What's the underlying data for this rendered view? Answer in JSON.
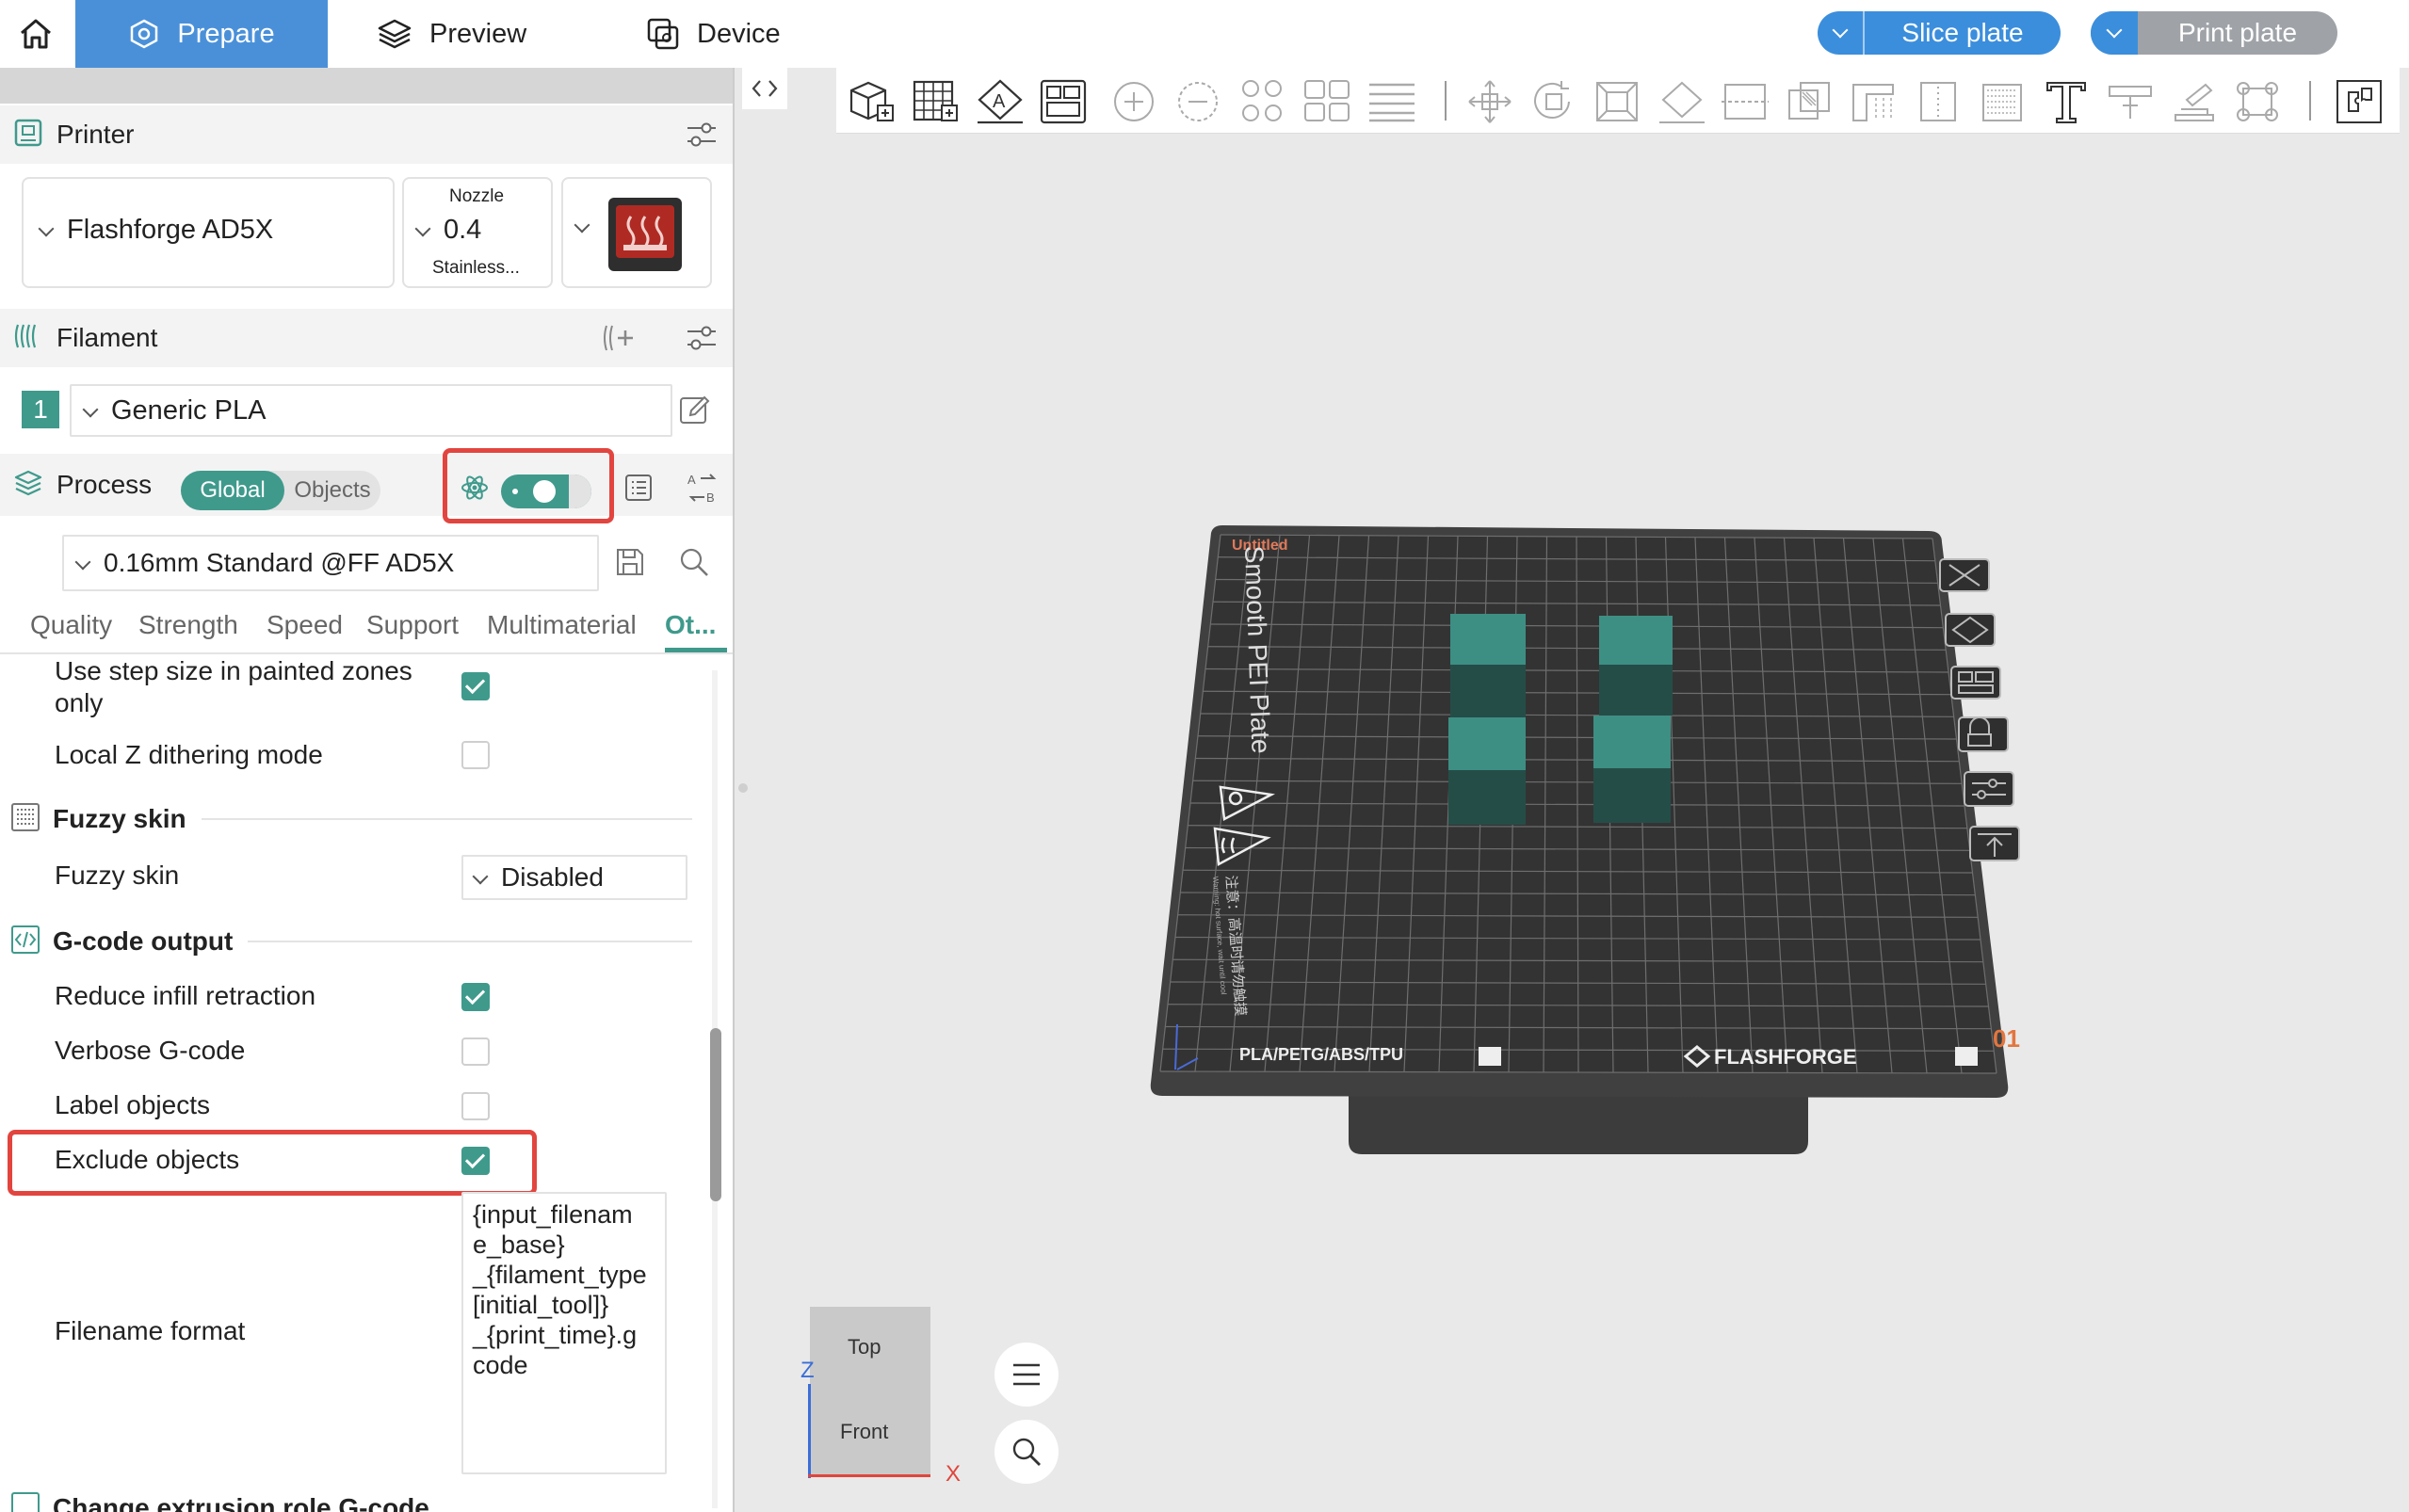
{
  "topbar": {
    "tabs": [
      {
        "label": "Prepare"
      },
      {
        "label": "Preview"
      },
      {
        "label": "Device"
      }
    ],
    "slice_label": "Slice plate",
    "print_label": "Print plate"
  },
  "printer": {
    "section_title": "Printer",
    "name": "Flashforge AD5X",
    "nozzle_label": "Nozzle",
    "nozzle_size": "0.4",
    "nozzle_material": "Stainless..."
  },
  "filament": {
    "section_title": "Filament",
    "slot": "1",
    "name": "Generic PLA"
  },
  "process": {
    "section_title": "Process",
    "toggle_global": "Global",
    "toggle_objects": "Objects",
    "preset": "0.16mm Standard @FF AD5X",
    "tabs": [
      "Quality",
      "Strength",
      "Speed",
      "Support",
      "Multimaterial",
      "Ot..."
    ]
  },
  "settings": {
    "rows": [
      {
        "label": "Use step size in painted zones only",
        "checked": true
      },
      {
        "label": "Local Z dithering mode",
        "checked": false
      }
    ],
    "fuzzy_group": "Fuzzy skin",
    "fuzzy_label": "Fuzzy skin",
    "fuzzy_value": "Disabled",
    "gcode_group": "G-code output",
    "gcode_rows": [
      {
        "label": "Reduce infill retraction",
        "checked": true
      },
      {
        "label": "Verbose G-code",
        "checked": false
      },
      {
        "label": "Label objects",
        "checked": false
      },
      {
        "label": "Exclude objects",
        "checked": true
      }
    ],
    "filename_label": "Filename format",
    "filename_value": "{input_filename_base}_{filament_type[initial_tool]}_{print_time}.gcode",
    "filename_lines": [
      "{input_filenam",
      "e_base}",
      "_{filament_type",
      "[initial_tool]}",
      "_{print_time}.g",
      "code"
    ],
    "next_group": "Change extrusion role G-code"
  },
  "plate": {
    "name": "Untitled",
    "surface": "Smooth PEI Plate",
    "materials": "PLA/PETG/ABS/TPU",
    "brand": "FLASHFORGE",
    "number": "01",
    "warning": "注意：高温时请勿触摸",
    "warning_en": "Warning: hot surface, wait until cool"
  },
  "viewcube": {
    "top": "Top",
    "front": "Front",
    "axis_z": "Z",
    "axis_x": "X"
  },
  "colors": {
    "accent": "#3f9a8c",
    "tab_active": "#4a90d9",
    "highlight": "#e2453f",
    "plate": "#3a3a3a",
    "model": "#3a8c80"
  }
}
